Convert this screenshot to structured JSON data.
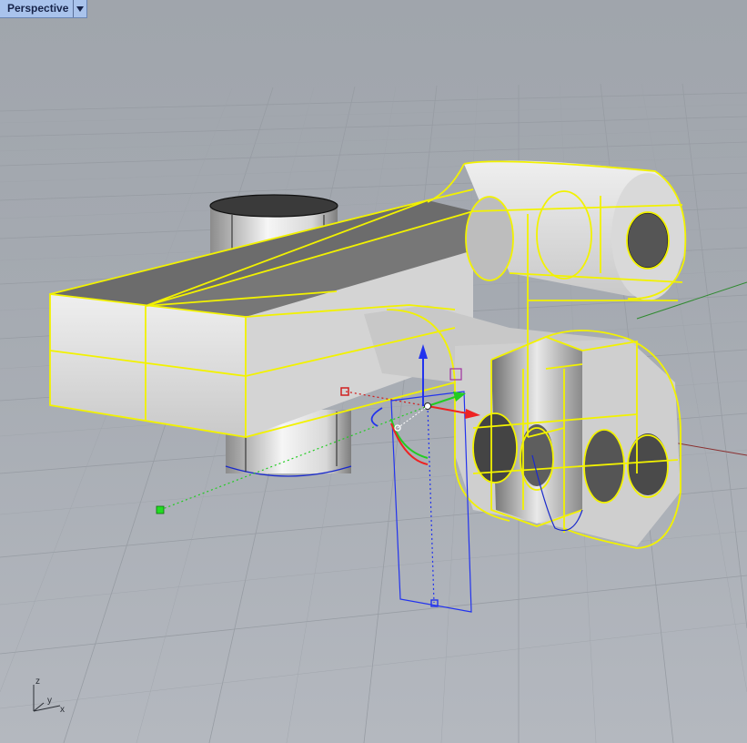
{
  "viewport": {
    "title": "Perspective",
    "menu_icon": "chevron-down-icon"
  },
  "axes_widget": {
    "z": "z",
    "y": "y",
    "x": "x"
  },
  "colors": {
    "background": "#a2a7ae",
    "grid": "#9da2a9",
    "selection": "#ffff00",
    "surface": "#dcdcdc",
    "gumball_x": "#ff2020",
    "gumball_y": "#22cc22",
    "gumball_z": "#2233ee"
  }
}
